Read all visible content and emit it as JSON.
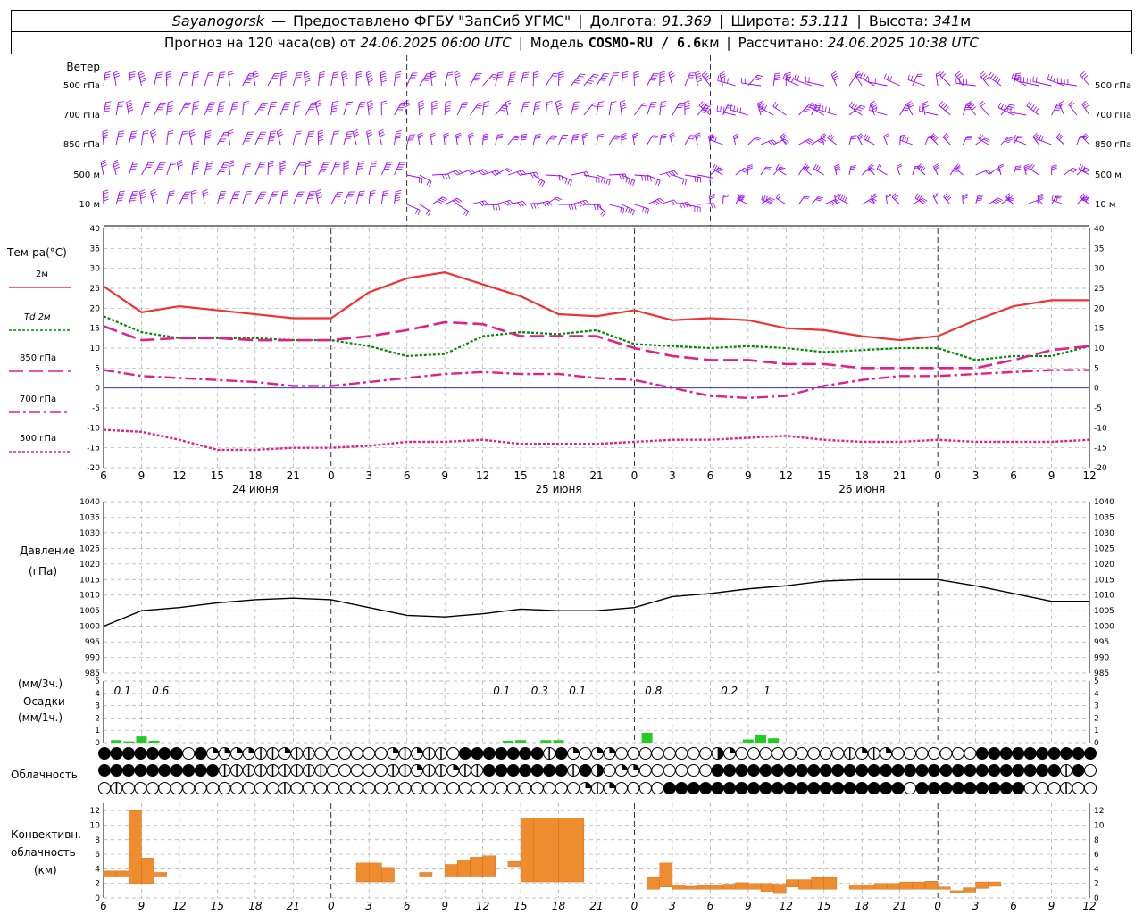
{
  "header": {
    "line1": {
      "station": "Sayanogorsk",
      "dash": "—",
      "provider": "Предоставлено ФГБУ \"ЗапСиб УГМС\"",
      "lon_label": "Долгота:",
      "lon": "91.369",
      "lat_label": "Широта:",
      "lat": "53.111",
      "alt_label": "Высота:",
      "alt": "341",
      "alt_unit": "м"
    },
    "line2": {
      "forecast": "Прогноз на 120 часа(ов) от",
      "start": "24.06.2025 06:00 UTC",
      "model_label": "Модель",
      "model": "COSMO-RU / 6.6",
      "model_unit": "км",
      "calc_label": "Рассчитано:",
      "calc": "24.06.2025 10:38 UTC"
    }
  },
  "time_axis": {
    "hour_labels": [
      "6",
      "9",
      "12",
      "15",
      "18",
      "21",
      "0",
      "3",
      "6",
      "9",
      "12",
      "15",
      "18",
      "21",
      "0",
      "3",
      "6",
      "9",
      "12",
      "15",
      "18",
      "21",
      "0",
      "3",
      "6",
      "9",
      "12"
    ],
    "day_labels": [
      "24 июня",
      "25 июня",
      "26 июня"
    ]
  },
  "wind_panel": {
    "title": "Ветер",
    "levels": [
      "500 гПа",
      "700 гПа",
      "850 гПа",
      "500 м",
      "10 м"
    ],
    "color": "#9900ff"
  },
  "colors": {
    "t2m": "#ee3333",
    "td2m": "#008800",
    "t850": "#e0208a",
    "t700": "#e0208a",
    "t500": "#e0208a",
    "zero": "#3333cc",
    "precip": "#22cc22",
    "conv": "#f08c30",
    "pressure": "#000000"
  },
  "chart_data": [
    {
      "type": "line",
      "title": "Тем-ра(°C)",
      "ylim": [
        -20,
        40
      ],
      "y_ticks": [
        "40",
        "35",
        "30",
        "25",
        "20",
        "15",
        "10",
        "5",
        "0",
        "-5",
        "-10",
        "-15",
        "-20"
      ],
      "x_hours": [
        0,
        3,
        6,
        9,
        12,
        15,
        18,
        21,
        24,
        27,
        30,
        33,
        36,
        39,
        42,
        45,
        48,
        51,
        54,
        57,
        60,
        63,
        66,
        69,
        72,
        75,
        78
      ],
      "series": [
        {
          "name": "2м",
          "values": [
            25.5,
            19,
            20.5,
            19.5,
            18.5,
            17.5,
            17.5,
            24,
            27.5,
            29,
            26,
            23,
            18.5,
            18,
            19.5,
            17,
            17.5,
            17,
            15,
            14.5,
            13,
            12,
            13,
            17,
            20.5,
            22,
            22
          ]
        },
        {
          "name": "Td 2м",
          "values": [
            18,
            14,
            12.5,
            12.5,
            12.5,
            12,
            12,
            10.5,
            8,
            8.5,
            13,
            14,
            13.5,
            14.5,
            11,
            10.5,
            10,
            10.5,
            10,
            9,
            9.5,
            10,
            10,
            7,
            8,
            8,
            10.5
          ]
        },
        {
          "name": "850 гПа",
          "values": [
            15.5,
            12,
            12.5,
            12.5,
            12,
            12,
            12,
            13,
            14.5,
            16.5,
            16,
            13,
            13,
            13,
            10,
            8,
            7,
            7,
            6,
            6,
            5,
            5,
            5,
            5,
            7,
            9.5,
            10.5
          ]
        },
        {
          "name": "700 гПа",
          "values": [
            4.5,
            3,
            2.5,
            2,
            1.5,
            0.5,
            0.5,
            1.5,
            2.5,
            3.5,
            4,
            3.5,
            3.5,
            2.5,
            2,
            0,
            -2,
            -2.5,
            -2,
            0.5,
            2,
            3,
            3,
            3.5,
            4,
            4.5,
            4.5
          ]
        },
        {
          "name": "500 гПа",
          "values": [
            -10.5,
            -11,
            -13,
            -15.5,
            -15.5,
            -15,
            -15,
            -14.5,
            -13.5,
            -13.5,
            -13,
            -14,
            -14,
            -14,
            -13.5,
            -13,
            -13,
            -12.5,
            -12,
            -13,
            -13.5,
            -13.5,
            -13,
            -13.5,
            -13.5,
            -13.5,
            -13
          ]
        }
      ]
    },
    {
      "type": "line",
      "title": "Давление",
      "ylabel": "(гПа)",
      "ylim": [
        985,
        1040
      ],
      "y_ticks": [
        "1040",
        "1035",
        "1030",
        "1025",
        "1020",
        "1015",
        "1010",
        "1005",
        "1000",
        "995",
        "990",
        "985"
      ],
      "x_hours": [
        0,
        3,
        6,
        9,
        12,
        15,
        18,
        21,
        24,
        27,
        30,
        33,
        36,
        39,
        42,
        45,
        48,
        51,
        54,
        57,
        60,
        63,
        66,
        69,
        72,
        75,
        78
      ],
      "series": [
        {
          "values": [
            1000,
            1005,
            1006,
            1007.5,
            1008.5,
            1009,
            1008.5,
            1006,
            1003.5,
            1003,
            1004,
            1005.5,
            1005,
            1005,
            1006,
            1009.5,
            1010.5,
            1012,
            1013,
            1014.5,
            1015,
            1015,
            1015,
            1013,
            1010.5,
            1008,
            1008
          ]
        }
      ]
    },
    {
      "type": "bar",
      "title": "Осадки",
      "ylabel": "(мм/3ч.)",
      "ylabel2": "(мм/1ч.)",
      "ylim": [
        0,
        5
      ],
      "y_ticks": [
        "5",
        "4",
        "3",
        "2",
        "1",
        "0"
      ],
      "bars_hour": [
        1,
        2,
        3,
        4,
        32,
        33,
        35,
        36,
        43,
        51,
        52,
        53
      ],
      "bars_value": [
        0.2,
        0.1,
        0.5,
        0.15,
        0.15,
        0.2,
        0.2,
        0.2,
        0.8,
        0.25,
        0.6,
        0.35
      ],
      "labels_hour": [
        1.5,
        4.5,
        31.5,
        34.5,
        37.5,
        43.5,
        49.5,
        52.5
      ],
      "labels": [
        "0.1",
        "0.6",
        "0.1",
        "0.3",
        "0.1",
        "0.8",
        "0.2",
        "1"
      ]
    },
    {
      "type": "bar",
      "title": "Конвективн.",
      "ylabel": "облачность",
      "unit": "(км)",
      "ylim": [
        0,
        13
      ],
      "y_ticks": [
        "12",
        "10",
        "8",
        "6",
        "4",
        "2",
        "0"
      ],
      "bars": [
        {
          "x": 0,
          "lo": 3,
          "hi": 3.7
        },
        {
          "x": 1,
          "lo": 3,
          "hi": 3.7
        },
        {
          "x": 2,
          "lo": 2,
          "hi": 12
        },
        {
          "x": 3,
          "lo": 2,
          "hi": 5.5
        },
        {
          "x": 4,
          "lo": 3,
          "hi": 3.5
        },
        {
          "x": 20,
          "lo": 2.2,
          "hi": 4.8
        },
        {
          "x": 21,
          "lo": 2.2,
          "hi": 4.8
        },
        {
          "x": 22,
          "lo": 2.2,
          "hi": 4.2
        },
        {
          "x": 25,
          "lo": 3,
          "hi": 3.5
        },
        {
          "x": 27,
          "lo": 3,
          "hi": 4.6
        },
        {
          "x": 28,
          "lo": 3,
          "hi": 5.2
        },
        {
          "x": 29,
          "lo": 3,
          "hi": 5.6
        },
        {
          "x": 30,
          "lo": 3,
          "hi": 5.8
        },
        {
          "x": 32,
          "lo": 4.3,
          "hi": 5
        },
        {
          "x": 33,
          "lo": 2.2,
          "hi": 11
        },
        {
          "x": 34,
          "lo": 2.2,
          "hi": 11
        },
        {
          "x": 35,
          "lo": 2.2,
          "hi": 11
        },
        {
          "x": 36,
          "lo": 2.2,
          "hi": 11
        },
        {
          "x": 37,
          "lo": 2.2,
          "hi": 11
        },
        {
          "x": 43,
          "lo": 1.2,
          "hi": 2.8
        },
        {
          "x": 44,
          "lo": 1.5,
          "hi": 4.8
        },
        {
          "x": 45,
          "lo": 1.2,
          "hi": 1.8
        },
        {
          "x": 46,
          "lo": 1.2,
          "hi": 1.6
        },
        {
          "x": 47,
          "lo": 1.2,
          "hi": 1.7
        },
        {
          "x": 48,
          "lo": 1.2,
          "hi": 1.8
        },
        {
          "x": 49,
          "lo": 1.2,
          "hi": 1.9
        },
        {
          "x": 50,
          "lo": 1.2,
          "hi": 2.1
        },
        {
          "x": 51,
          "lo": 1.2,
          "hi": 2
        },
        {
          "x": 52,
          "lo": 0.9,
          "hi": 2
        },
        {
          "x": 53,
          "lo": 0.6,
          "hi": 1.9
        },
        {
          "x": 54,
          "lo": 1.5,
          "hi": 2.5
        },
        {
          "x": 55,
          "lo": 1.2,
          "hi": 2.5
        },
        {
          "x": 56,
          "lo": 1.2,
          "hi": 2.8
        },
        {
          "x": 57,
          "lo": 1.2,
          "hi": 2.8
        },
        {
          "x": 59,
          "lo": 1.2,
          "hi": 1.8
        },
        {
          "x": 60,
          "lo": 1.2,
          "hi": 1.8
        },
        {
          "x": 61,
          "lo": 1.2,
          "hi": 2
        },
        {
          "x": 62,
          "lo": 1.2,
          "hi": 2
        },
        {
          "x": 63,
          "lo": 1.2,
          "hi": 2.2
        },
        {
          "x": 64,
          "lo": 1.2,
          "hi": 2.2
        },
        {
          "x": 65,
          "lo": 1.2,
          "hi": 2.3
        },
        {
          "x": 66,
          "lo": 1.2,
          "hi": 1.5
        },
        {
          "x": 67,
          "lo": 0.7,
          "hi": 1
        },
        {
          "x": 68,
          "lo": 0.8,
          "hi": 1.4
        },
        {
          "x": 69,
          "lo": 1.3,
          "hi": 2.2
        },
        {
          "x": 70,
          "lo": 1.6,
          "hi": 2.2
        }
      ]
    }
  ],
  "cloud_panel": {
    "title": "Облачность",
    "rows": [
      "99999990922221121100000021211099999991920220000000032000000000121200000009999999999",
      "99999999991111111110000011211211999999919302200000099999999999999999999999999999190",
      "01000000000000010000000000000000000000002120000999999999999999999990999999999000100"
    ]
  }
}
